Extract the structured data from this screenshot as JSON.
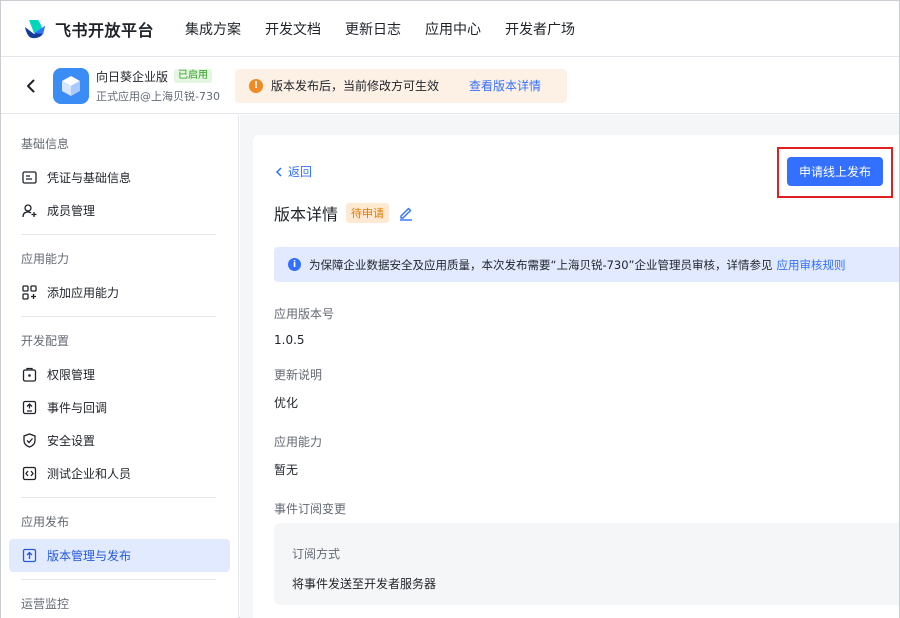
{
  "topnav": {
    "brand": "飞书开放平台",
    "items": [
      "集成方案",
      "开发文档",
      "更新日志",
      "应用中心",
      "开发者广场"
    ]
  },
  "app": {
    "name": "向日葵企业版",
    "status": "已启用",
    "subtitle": "正式应用@上海贝锐-730",
    "notice_text": "版本发布后，当前修改方可生效",
    "notice_link": "查看版本详情"
  },
  "sidebar": {
    "groups": [
      {
        "label": "基础信息",
        "items": [
          {
            "label": "凭证与基础信息",
            "icon": "id-card-icon"
          },
          {
            "label": "成员管理",
            "icon": "person-add-icon"
          }
        ]
      },
      {
        "label": "应用能力",
        "items": [
          {
            "label": "添加应用能力",
            "icon": "grid-add-icon"
          }
        ]
      },
      {
        "label": "开发配置",
        "items": [
          {
            "label": "权限管理",
            "icon": "lock-box-icon"
          },
          {
            "label": "事件与回调",
            "icon": "event-box-icon"
          },
          {
            "label": "安全设置",
            "icon": "shield-icon"
          },
          {
            "label": "测试企业和人员",
            "icon": "code-box-icon"
          }
        ]
      },
      {
        "label": "应用发布",
        "items": [
          {
            "label": "版本管理与发布",
            "icon": "upload-box-icon"
          }
        ]
      },
      {
        "label": "运营监控",
        "items": []
      }
    ]
  },
  "main": {
    "back_label": "返回",
    "publish_button": "申请线上发布",
    "title": "版本详情",
    "status_badge": "待申请",
    "info_text": "为保障企业数据安全及应用质量，本次发布需要“上海贝锐-730”企业管理员审核，详情参见",
    "info_link": "应用审核规则",
    "fields": [
      {
        "label": "应用版本号",
        "value": "1.0.5"
      },
      {
        "label": "更新说明",
        "value": "优化"
      },
      {
        "label": "应用能力",
        "value": "暂无"
      },
      {
        "label": "事件订阅变更",
        "value": ""
      }
    ],
    "subscription": {
      "label": "订阅方式",
      "value": "将事件发送至开发者服务器"
    }
  },
  "colors": {
    "accent": "#3370ff",
    "warning": "#f08a24",
    "highlight_frame": "#e02020"
  }
}
